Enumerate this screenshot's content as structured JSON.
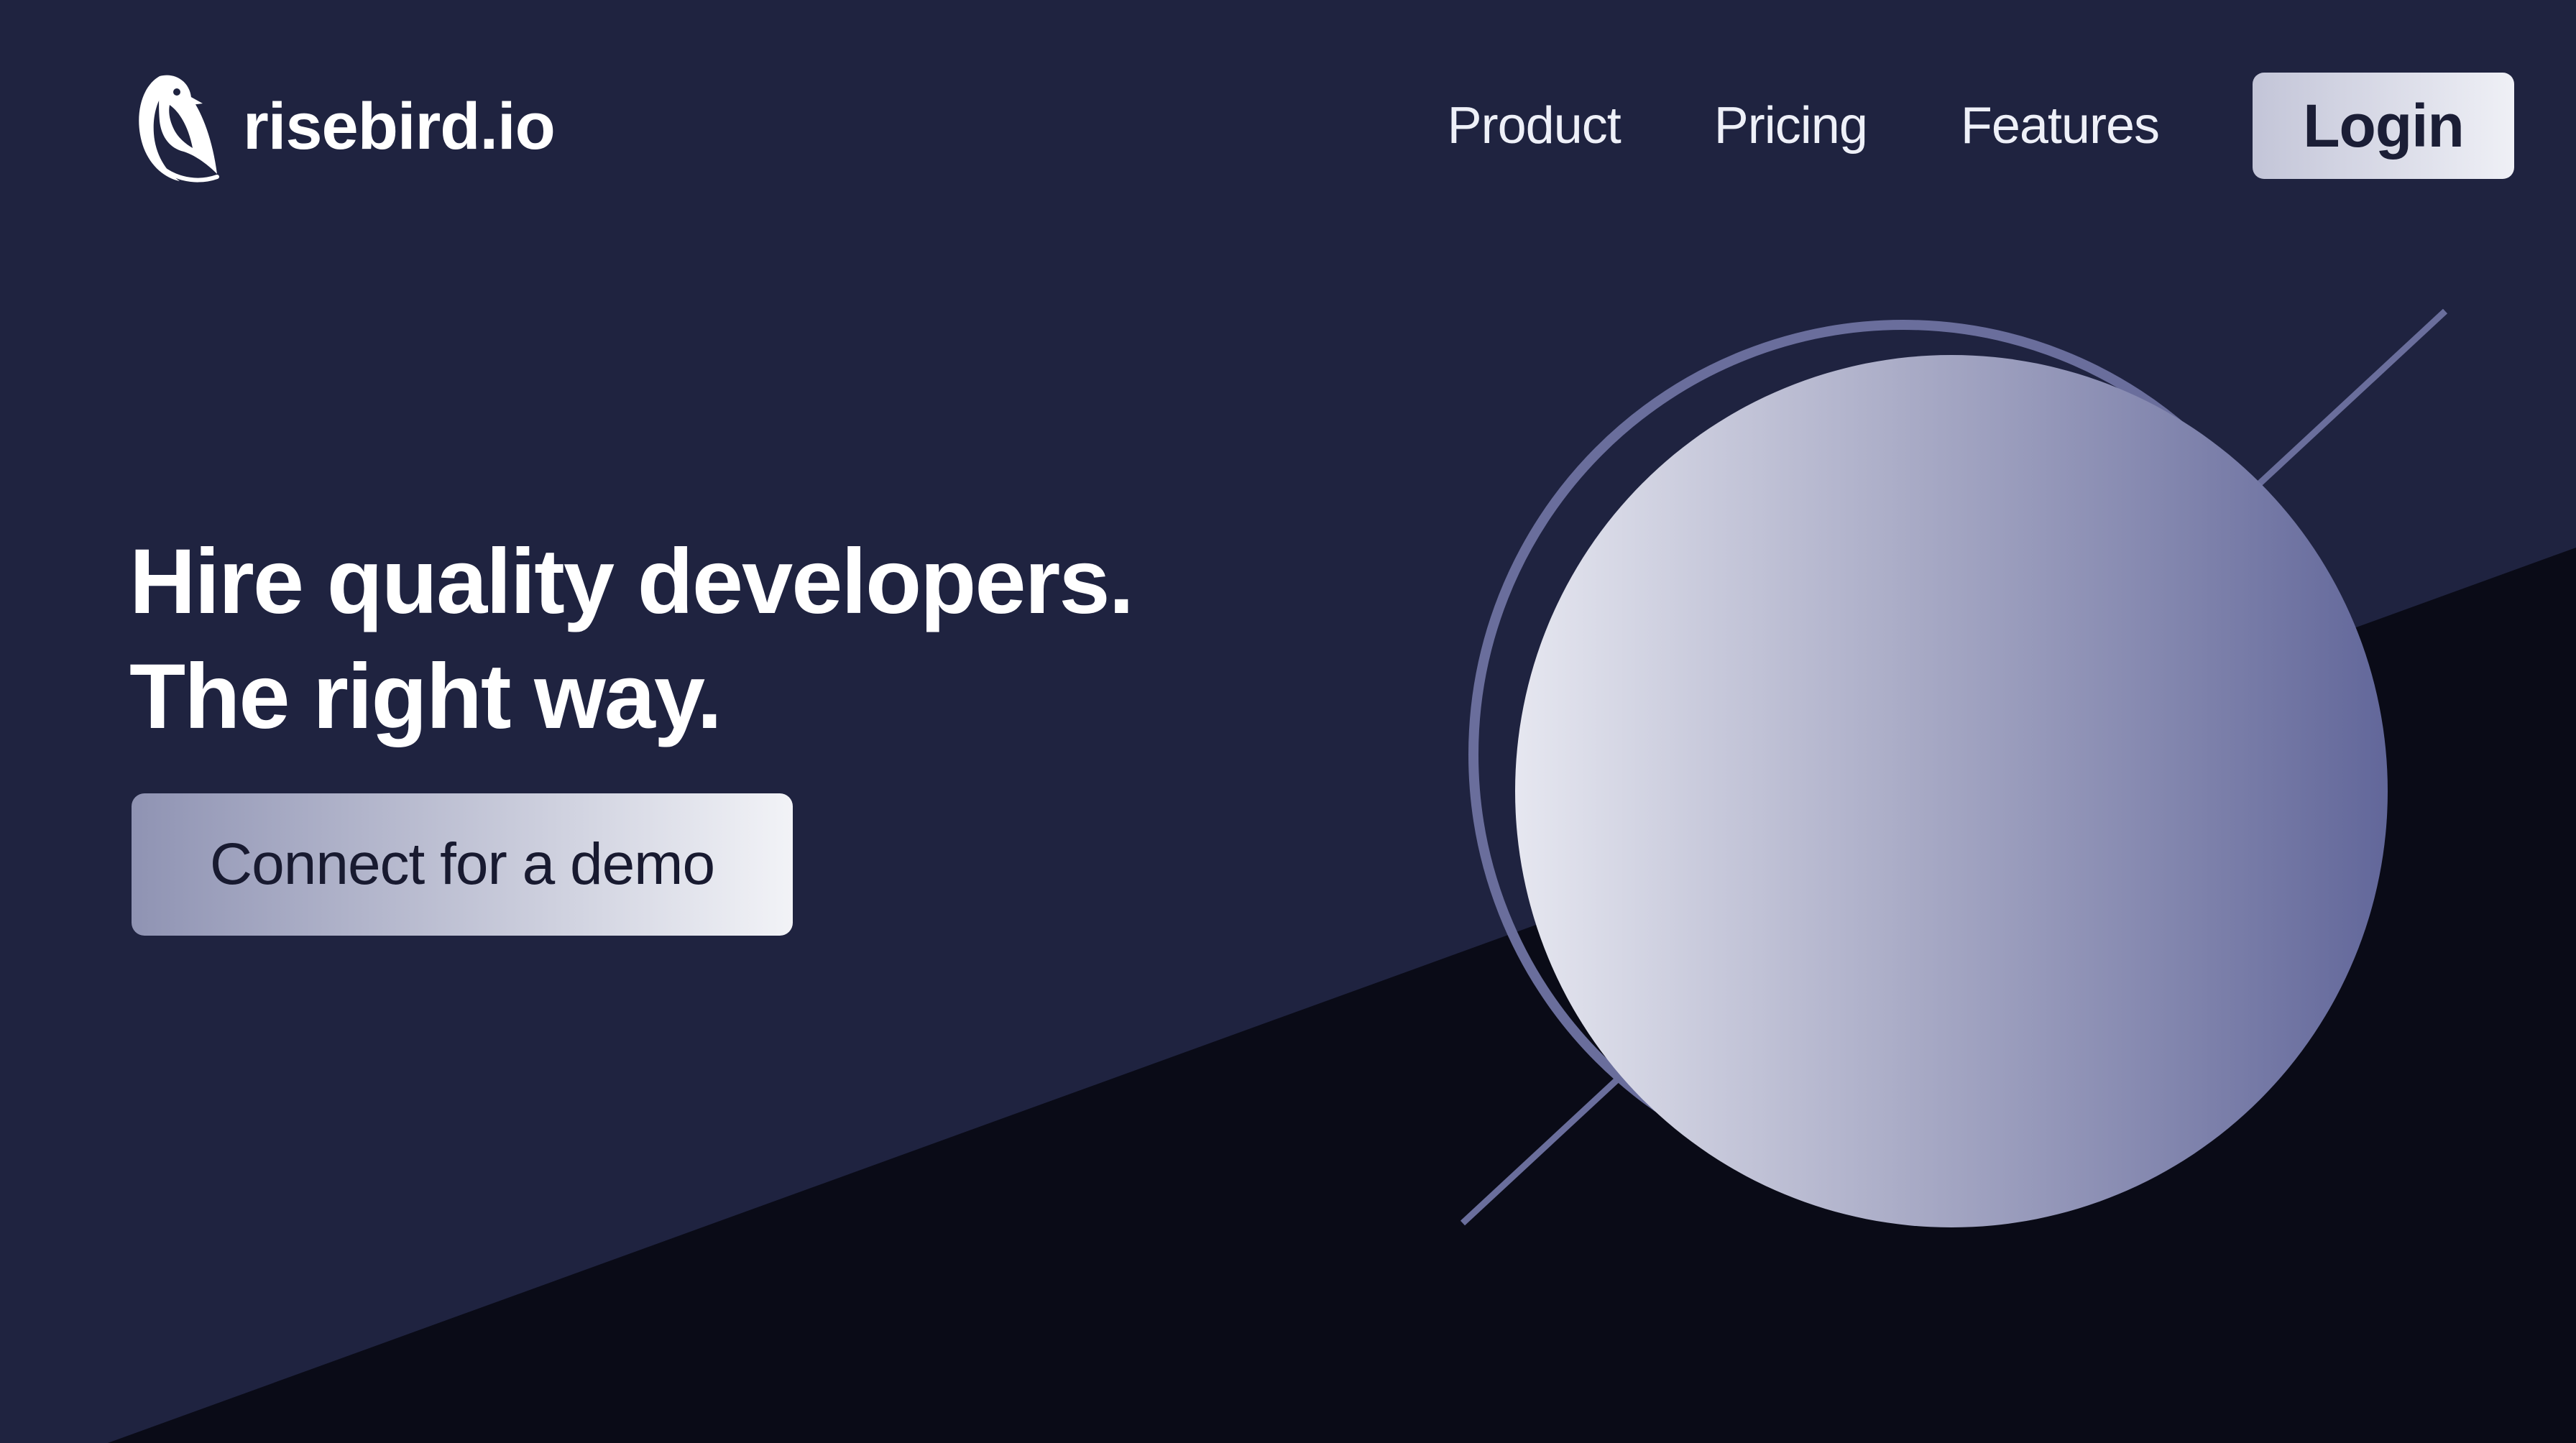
{
  "brand": {
    "logo_icon": "bird-icon",
    "name": "risebird.io"
  },
  "nav": {
    "items": [
      {
        "label": "Product"
      },
      {
        "label": "Pricing"
      },
      {
        "label": "Features"
      }
    ],
    "login_label": "Login"
  },
  "hero": {
    "headline_line1": "Hire quality developers.",
    "headline_line2": "The right way.",
    "cta_label": "Connect for a demo"
  },
  "colors": {
    "background_navy": "#1f2340",
    "background_dark": "#0a0b17",
    "accent_periwinkle": "#6a6e9c",
    "button_light": "#eff0f6",
    "text_white": "#ffffff"
  }
}
